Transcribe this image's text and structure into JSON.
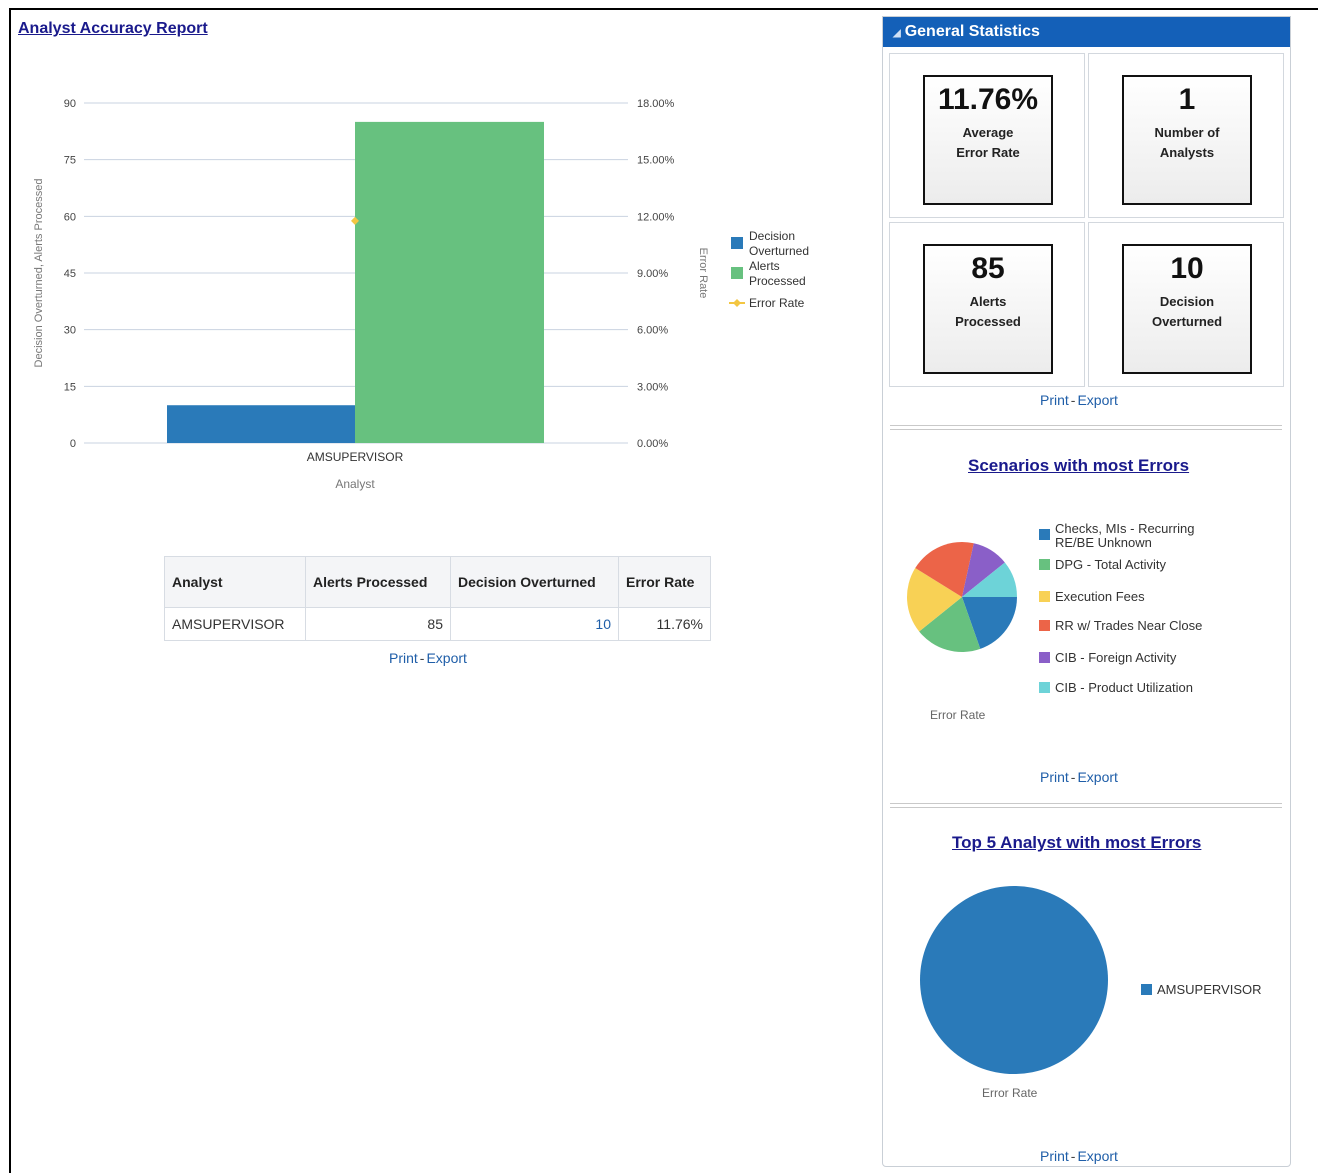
{
  "report": {
    "title": "Analyst Accuracy Report"
  },
  "chart_data": [
    {
      "type": "bar",
      "categories": [
        "AMSUPERVISOR"
      ],
      "series": [
        {
          "name": "Decision Overturned",
          "values": [
            10
          ],
          "color": "#2a7ab9",
          "axis": "left"
        },
        {
          "name": "Alerts Processed",
          "values": [
            85
          ],
          "color": "#67c17f",
          "axis": "left"
        },
        {
          "name": "Error Rate",
          "values": [
            11.76
          ],
          "color": "#f3c642",
          "axis": "right",
          "kind": "line-point"
        }
      ],
      "xlabel": "Analyst",
      "ylabel": "Decision Overturned, Alerts Processed",
      "y2label": "Error Rate",
      "ylim": [
        0,
        90
      ],
      "yticks": [
        "0",
        "15",
        "30",
        "45",
        "60",
        "75",
        "90"
      ],
      "y2lim": [
        0,
        18
      ],
      "y2ticks": [
        "0.00%",
        "3.00%",
        "6.00%",
        "9.00%",
        "12.00%",
        "15.00%",
        "18.00%"
      ],
      "grid": true,
      "legend": "right"
    },
    {
      "type": "pie",
      "title": "Scenarios with most Errors",
      "caption": "Error Rate",
      "slices": [
        {
          "label": "Checks, MIs - Recurring RE/BE Unknown",
          "value": 1,
          "color": "#2a7ab9"
        },
        {
          "label": "DPG - Total Activity",
          "value": 1,
          "color": "#67c17f"
        },
        {
          "label": "Execution Fees",
          "value": 1,
          "color": "#f8d155"
        },
        {
          "label": "RR w/ Trades Near Close",
          "value": 1,
          "color": "#ec6448"
        },
        {
          "label": "CIB - Foreign Activity",
          "value": 0.55,
          "color": "#8a5fc8"
        },
        {
          "label": "CIB - Product Utilization",
          "value": 0.55,
          "color": "#6dd3d8"
        }
      ],
      "legend": "right"
    },
    {
      "type": "pie",
      "title": "Top 5 Analyst with most Errors",
      "caption": "Error Rate",
      "slices": [
        {
          "label": "AMSUPERVISOR",
          "value": 100,
          "color": "#2a7ab9"
        }
      ],
      "legend": "right"
    }
  ],
  "table": {
    "headers": [
      "Analyst",
      "Alerts Processed",
      "Decision Overturned",
      "Error Rate"
    ],
    "rows": [
      {
        "analyst": "AMSUPERVISOR",
        "alerts": "85",
        "overturned": "10",
        "rate": "11.76%"
      }
    ]
  },
  "actions": {
    "print": "Print",
    "sep": "-",
    "export": "Export"
  },
  "panel": {
    "title": "General Statistics",
    "stats": [
      {
        "value": "11.76%",
        "label1": "Average",
        "label2": "Error Rate"
      },
      {
        "value": "1",
        "label1": "Number of",
        "label2": "Analysts"
      },
      {
        "value": "85",
        "label1": "Alerts",
        "label2": "Processed"
      },
      {
        "value": "10",
        "label1": "Decision",
        "label2": "Overturned"
      }
    ]
  }
}
